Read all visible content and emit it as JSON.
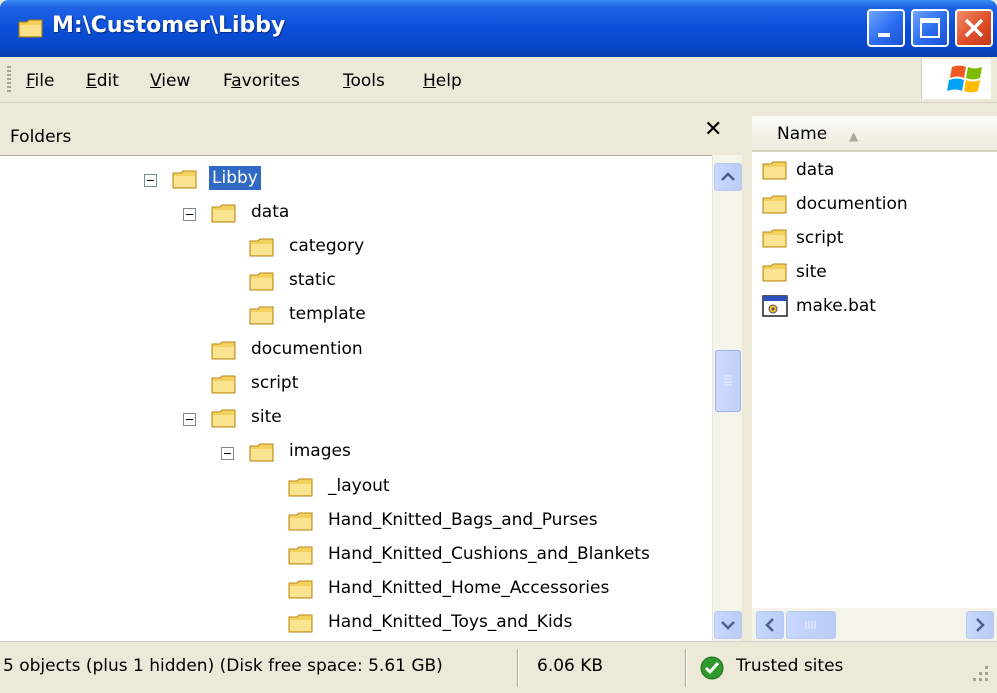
{
  "window": {
    "title": "M:\\Customer\\Libby"
  },
  "menu": {
    "items": [
      {
        "label": "File",
        "accel": "F",
        "rest": "ile"
      },
      {
        "label": "Edit",
        "accel": "E",
        "rest": "dit"
      },
      {
        "label": "View",
        "accel": "V",
        "rest": "iew"
      },
      {
        "label": "Favorites",
        "pre": "F",
        "accel": "a",
        "rest": "vorites"
      },
      {
        "label": "Tools",
        "accel": "T",
        "rest": "ools"
      },
      {
        "label": "Help",
        "accel": "H",
        "rest": "elp"
      }
    ]
  },
  "folders_pane": {
    "title": "Folders",
    "close_glyph": "✕",
    "tree": [
      {
        "label": "Libby",
        "expanded": true,
        "selected": true,
        "depth": 0
      },
      {
        "label": "data",
        "expanded": true,
        "depth": 1
      },
      {
        "label": "category",
        "depth": 2
      },
      {
        "label": "static",
        "depth": 2
      },
      {
        "label": "template",
        "depth": 2
      },
      {
        "label": "documention",
        "depth": 1
      },
      {
        "label": "script",
        "depth": 1
      },
      {
        "label": "site",
        "expanded": true,
        "depth": 1
      },
      {
        "label": "images",
        "expanded": true,
        "depth": 2
      },
      {
        "label": "_layout",
        "depth": 3
      },
      {
        "label": "Hand_Knitted_Bags_and_Purses",
        "depth": 3
      },
      {
        "label": "Hand_Knitted_Cushions_and_Blankets",
        "depth": 3
      },
      {
        "label": "Hand_Knitted_Home_Accessories",
        "depth": 3
      },
      {
        "label": "Hand_Knitted_Toys_and_Kids",
        "depth": 3
      }
    ]
  },
  "file_list": {
    "column_name": "Name",
    "sort_indicator": "▲",
    "items": [
      {
        "label": "data",
        "icon": "folder-icon"
      },
      {
        "label": "documention",
        "icon": "folder-icon"
      },
      {
        "label": "script",
        "icon": "folder-icon"
      },
      {
        "label": "site",
        "icon": "folder-icon"
      },
      {
        "label": "make.bat",
        "icon": "batch-file-icon"
      }
    ]
  },
  "status": {
    "objects": "5 objects (plus 1 hidden) (Disk free space: 5.61 GB)",
    "size": "6.06 KB",
    "zone": "Trusted sites"
  },
  "colors": {
    "title_bar": "#0a4fd8",
    "selection": "#316ac5",
    "folder": "#f3d15f",
    "trusted_zone": "#2e9a2e"
  }
}
